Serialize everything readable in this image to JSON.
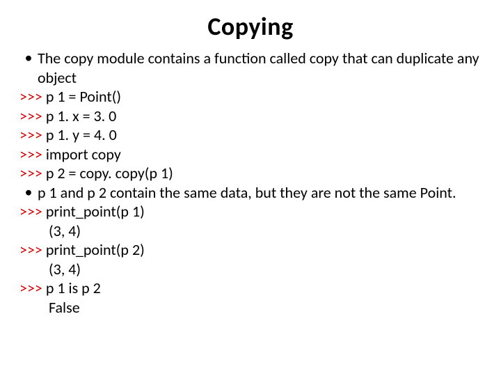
{
  "title": "Copying",
  "bullets": {
    "b1": "The copy module contains a function called copy that can duplicate any object",
    "b2": "p 1 and p 2 contain the same data, but they are not the same Point."
  },
  "code": {
    "l1_prompt": ">>> ",
    "l1": "p 1 = Point()",
    "l2_prompt": ">>> ",
    "l2": "p 1. x = 3. 0",
    "l3_prompt": ">>> ",
    "l3": "p 1. y = 4. 0",
    "l4_prompt": ">>> ",
    "l4": "import copy",
    "l5_prompt": ">>> ",
    "l5": "p 2 = copy. copy(p 1)",
    "l6_prompt": ">>> ",
    "l6": "print_point(p 1)",
    "l7": "(3, 4)",
    "l8_prompt": ">>> ",
    "l8": "print_point(p 2)",
    "l9": "(3, 4)",
    "l10_prompt": ">>> ",
    "l10": "p 1 is p 2",
    "l11": "False"
  }
}
